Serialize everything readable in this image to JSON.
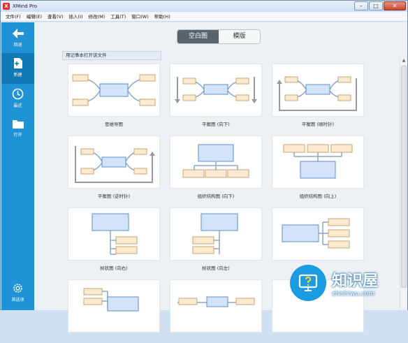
{
  "window": {
    "app_icon": "X",
    "title": "XMind Pro",
    "minimize": "–",
    "maximize": "□",
    "close": "✕"
  },
  "menu": [
    "文件(F)",
    "编辑(E)",
    "查看(V)",
    "插入(I)",
    "修改(M)",
    "工具(T)",
    "窗口(W)",
    "帮助(H)"
  ],
  "sidebar": {
    "back": "回退",
    "new": "新建",
    "recent": "最近",
    "open": "打开",
    "preferences": "首选项"
  },
  "tabs": {
    "blank": "空白图",
    "template": "模版"
  },
  "open_with_notepad": "用记事本打开该文件",
  "templates": [
    "思维导图",
    "平衡图 (向下)",
    "平衡图 (顺时针)",
    "平衡图 (逆时针)",
    "组织结构图 (向下)",
    "组织结构图 (向上)",
    "树状图 (向右)",
    "树状图 (向左)",
    "",
    "",
    "",
    ""
  ],
  "watermark": {
    "brand": "知识屋",
    "url": "zhishiwu.com"
  },
  "colors": {
    "sidebar": "#1f93d6",
    "node_fill": "#d3e3f9",
    "node_stroke": "#5a8ed0",
    "branch_fill": "#fbe9d2",
    "branch_stroke": "#c9a66f"
  }
}
